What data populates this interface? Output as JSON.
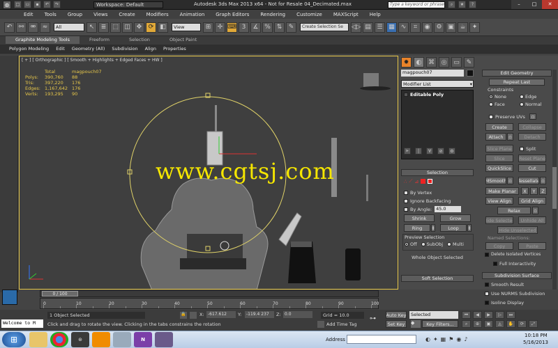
{
  "title_bar": {
    "workspace_label": "Workspace: Default",
    "title": "Autodesk 3ds Max  2013 x64    - Not for Resale   04_Decimated.max",
    "search_placeholder": "Type a keyword or phrase"
  },
  "menu": [
    "Edit",
    "Tools",
    "Group",
    "Views",
    "Create",
    "Modifiers",
    "Animation",
    "Graph Editors",
    "Rendering",
    "Customize",
    "MAXScript",
    "Help"
  ],
  "main_toolbar": {
    "selection_filter": "All",
    "ref_coord": "View",
    "named_selection": "Create Selection Se"
  },
  "ribbon": {
    "tabs": [
      "Graphite Modeling Tools",
      "Freeform",
      "Selection",
      "Object Paint"
    ],
    "subtabs": [
      "Polygon Modeling",
      "Edit",
      "Geometry (All)",
      "Subdivision",
      "Align",
      "Properties"
    ]
  },
  "viewport": {
    "label": "[ + ] [ Orthographic ] [ Smooth + Highlights + Edged Faces + HW ]",
    "stats": {
      "header": [
        "",
        "Total",
        "magpouch07"
      ],
      "rows": [
        [
          "Polys:",
          "390,760",
          "88"
        ],
        [
          "Tris:",
          "397,220",
          "176"
        ],
        [
          "Edges:",
          "1,167,642",
          "176"
        ],
        [
          "Verts:",
          "193,295",
          "90"
        ]
      ]
    },
    "watermark": "www.cgtsj.com",
    "gizmo_axis": {
      "x": "x",
      "y": "y",
      "z": "z"
    }
  },
  "command_panel": {
    "object_name": "magpouch07",
    "modifier_list": "Modifier List",
    "stack_item": "Editable Poly",
    "selection": {
      "header": "Selection",
      "by_vertex": "By Vertex",
      "ignore_backfacing": "Ignore Backfacing",
      "by_angle": "By Angle:",
      "angle_value": "45.0",
      "shrink": "Shrink",
      "grow": "Grow",
      "ring": "Ring",
      "loop": "Loop",
      "preview_label": "Preview Selection",
      "preview_options": [
        "Off",
        "SubObj",
        "Multi"
      ],
      "status": "Whole Object Selected"
    },
    "soft_selection": "Soft Selection"
  },
  "edit_geometry": {
    "header": "Edit Geometry",
    "repeat_last": "Repeat Last",
    "constraints": "Constraints",
    "constraint_opts": [
      "None",
      "Edge",
      "Face",
      "Normal"
    ],
    "preserve_uvs": "Preserve UVs",
    "create": "Create",
    "collapse": "Collapse",
    "attach": "Attach",
    "detach": "Detach",
    "slice_plane": "Slice Plane",
    "split": "Split",
    "slice": "Slice",
    "reset_plane": "Reset Plane",
    "quickslice": "QuickSlice",
    "cut": "Cut",
    "msmooth": "MSmooth",
    "tessellate": "Tessellate",
    "make_planar": "Make Planar",
    "x": "X",
    "y": "Y",
    "z": "Z",
    "view_align": "View Align",
    "grid_align": "Grid Align",
    "relax": "Relax",
    "hide_selected": "Hide Selected",
    "unhide_all": "Unhide All",
    "hide_unselected": "Hide Unselected",
    "named_selections": "Named Selections:",
    "copy": "Copy",
    "paste": "Paste",
    "delete_isolated": "Delete Isolated Vertices",
    "full_interactivity": "Full Interactivity",
    "subdiv_header": "Subdivision Surface",
    "smooth_result": "Smooth Result",
    "use_nurms": "Use NURMS Subdivision",
    "isoline": "Isoline Display"
  },
  "timeline": {
    "counter": "0 / 100",
    "ticks": [
      "0",
      "10",
      "20",
      "30",
      "40",
      "50",
      "60",
      "70",
      "80",
      "90",
      "100"
    ]
  },
  "status": {
    "maxscript": "Welcome to M",
    "selected": "1 Object Selected",
    "prompt": "Click and drag to rotate the view.  Clicking in the tabs constrains the rotation",
    "x_val": "-617.612",
    "y_val": "-119.4 237",
    "z_val": "0.0",
    "grid": "Grid = 10.0",
    "add_time_tag": "Add Time Tag",
    "auto_key": "Auto Key",
    "set_key": "Set Key",
    "selected_dd": "Selected",
    "key_filters": "Key Filters..."
  },
  "taskbar": {
    "address": "Address",
    "time": "10:18 PM",
    "date": "5/16/2013"
  },
  "colors": {
    "accent": "#e8832a",
    "selection_yellow": "#f5e600",
    "stats_yellow": "#e8c84a",
    "viewport_bg": "#3e3e3e"
  }
}
